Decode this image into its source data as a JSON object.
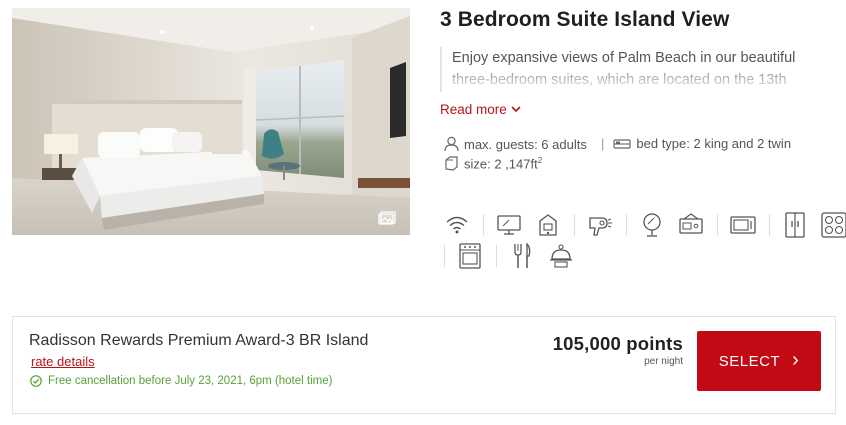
{
  "room": {
    "title": "3 Bedroom Suite Island View",
    "description": "Enjoy expansive views of Palm Beach in our beautiful three-bedroom suites, which are located on the 13th",
    "read_more": "Read more",
    "max_guests": "max. guests: 6 adults",
    "bed_type": "bed type: 2 king and 2 twin",
    "size_prefix": "size: 2 ,147ft",
    "size_sup": "2"
  },
  "amenities": [
    {
      "icon": "wifi-icon"
    },
    {
      "icon": "tv-icon"
    },
    {
      "icon": "coffee-maker-icon"
    },
    {
      "icon": "hair-dryer-icon"
    },
    {
      "icon": "vanity-mirror-icon"
    },
    {
      "icon": "safe-icon"
    },
    {
      "icon": "microwave-icon"
    },
    {
      "icon": "refrigerator-icon"
    },
    {
      "icon": "stovetop-icon"
    },
    {
      "icon": "oven-icon"
    },
    {
      "icon": "kitchen-utensils-icon"
    },
    {
      "icon": "room-service-icon"
    }
  ],
  "rate": {
    "name": "Radisson Rewards Premium Award-3 BR Island",
    "details_link": "rate details",
    "cancellation": "Free cancellation before July 23, 2021, 6pm (hotel time)",
    "points": "105,000 points",
    "per_night": "per night",
    "select_label": "SELECT",
    "select_arrow": "›"
  },
  "colors": {
    "accent_red": "#c20a14",
    "link_red": "#b8141b",
    "success_green": "#56a036"
  }
}
